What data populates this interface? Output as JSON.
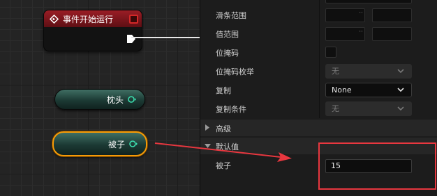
{
  "graph": {
    "event_node": {
      "title": "事件开始运行"
    },
    "var_nodes": [
      {
        "label": "枕头"
      },
      {
        "label": "被子"
      }
    ]
  },
  "panel": {
    "rows": {
      "slider_range": {
        "label": "滑条范围"
      },
      "value_range": {
        "label": "值范围"
      },
      "bitmask": {
        "label": "位掩码"
      },
      "bitmask_enum": {
        "label": "位掩码枚举",
        "value": "无"
      },
      "replication": {
        "label": "复制",
        "value": "None"
      },
      "replication_condition": {
        "label": "复制条件",
        "value": "无"
      }
    },
    "sections": {
      "advanced": {
        "title": "高级"
      },
      "default_value": {
        "title": "默认值"
      }
    },
    "default_row": {
      "label": "被子",
      "value": "15"
    },
    "range_dots": "··"
  },
  "colors": {
    "event_header": "#9a1d25",
    "variable_node": "#1c3a34",
    "selection": "#f59a08",
    "annotation": "#e8373f"
  },
  "icons": {
    "event": "diamond-arrow-icon",
    "exec": "exec-pin-icon",
    "data_pin": "data-pin-icon",
    "dropdown": "chevron-down-icon",
    "section_collapsed": "triangle-right-icon",
    "section_expanded": "triangle-down-icon"
  }
}
